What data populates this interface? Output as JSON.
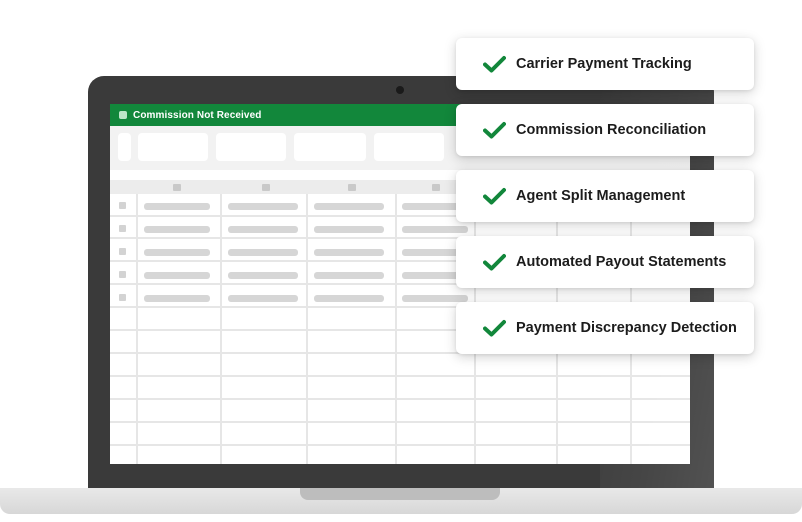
{
  "app": {
    "header_title": "Commission Not Received",
    "accent_color": "#12873b"
  },
  "features": [
    {
      "label": "Carrier Payment Tracking",
      "icon": "checkmark-icon"
    },
    {
      "label": "Commission Reconciliation",
      "icon": "checkmark-icon"
    },
    {
      "label": "Agent Split Management",
      "icon": "checkmark-icon"
    },
    {
      "label": "Automated Payout Statements",
      "icon": "checkmark-icon"
    },
    {
      "label": "Payment Discrepancy Detection",
      "icon": "checkmark-icon"
    }
  ]
}
